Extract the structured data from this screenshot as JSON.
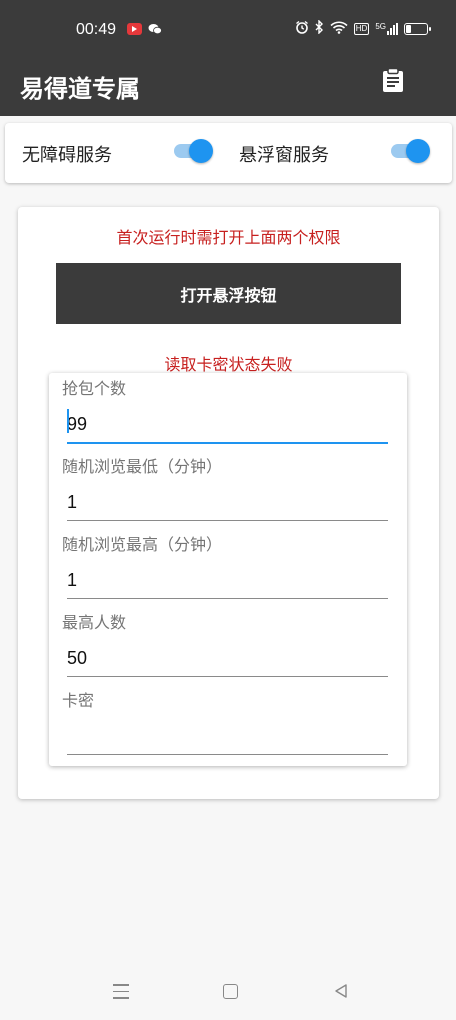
{
  "status_bar": {
    "time": "00:49",
    "left_icons": [
      "video-app-icon",
      "wechat-icon"
    ],
    "right_icons": [
      "alarm-icon",
      "bluetooth-icon",
      "wifi-icon",
      "hd-icon",
      "signal-icon",
      "battery-icon"
    ],
    "hd_label": "HD",
    "network_label": "5G"
  },
  "app_bar": {
    "title": "易得道专属",
    "action_icon": "clipboard-icon"
  },
  "services": {
    "accessibility_label": "无障碍服务",
    "accessibility_on": true,
    "floating_label": "悬浮窗服务",
    "floating_on": true
  },
  "main": {
    "notice": "首次运行时需打开上面两个权限",
    "float_button_label": "打开悬浮按钮",
    "card_status": "读取卡密状态失败"
  },
  "form": {
    "grab_count_label": "抢包个数",
    "grab_count_value": "99",
    "browse_min_label": "随机浏览最低（分钟）",
    "browse_min_value": "1",
    "browse_max_label": "随机浏览最高（分钟）",
    "browse_max_value": "1",
    "max_people_label": "最高人数",
    "max_people_value": "50",
    "card_key_label": "卡密",
    "card_key_value": ""
  },
  "nav_bar": {
    "icons": [
      "menu-icon",
      "home-icon",
      "back-icon"
    ]
  },
  "colors": {
    "bar": "#3b3b3b",
    "accent": "#1e94f0",
    "error_text": "#c7201f"
  }
}
